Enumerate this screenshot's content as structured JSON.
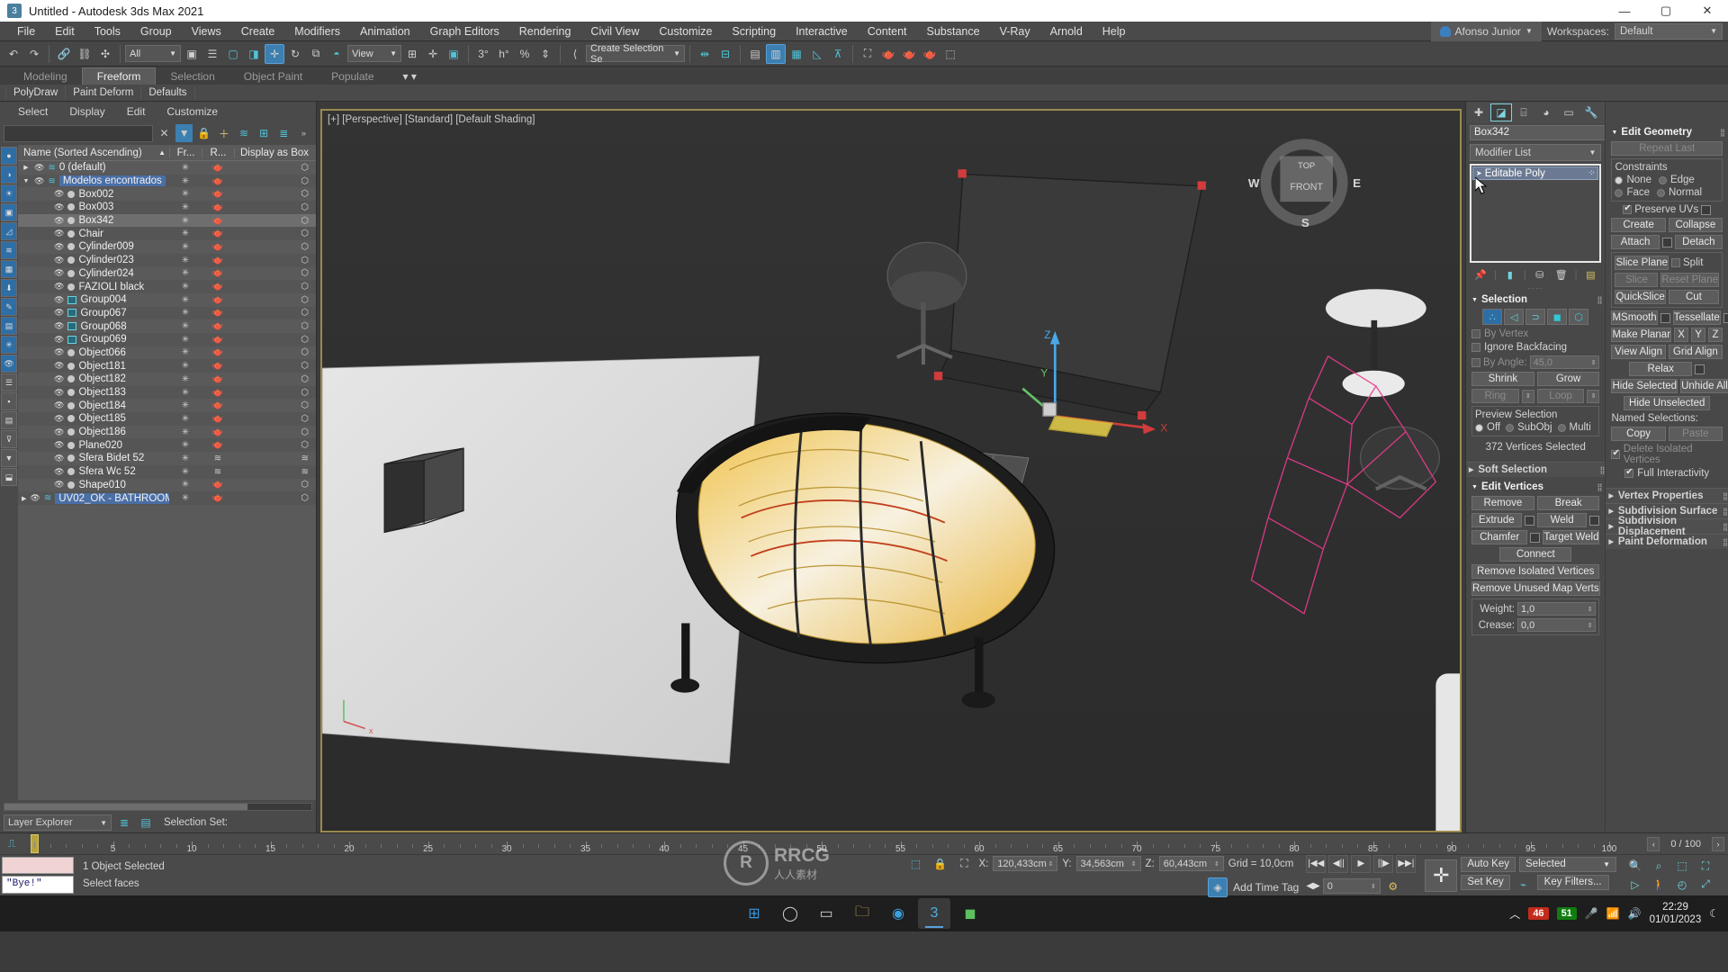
{
  "window": {
    "title": "Untitled - Autodesk 3ds Max 2021",
    "app_icon": "3ds-max-icon",
    "minimize": "—",
    "maximize": "▢",
    "close": "✕"
  },
  "menubar": {
    "items": [
      "File",
      "Edit",
      "Tools",
      "Group",
      "Views",
      "Create",
      "Modifiers",
      "Animation",
      "Graph Editors",
      "Rendering",
      "Civil View",
      "Customize",
      "Scripting",
      "Interactive",
      "Content",
      "Substance",
      "V-Ray",
      "Arnold",
      "Help"
    ],
    "user_name": "Afonso Junior",
    "workspaces_label": "Workspaces:",
    "workspace_value": "Default"
  },
  "toolbar": {
    "selection_filter": "All",
    "reference_coord": "View",
    "named_selection": "Create Selection Se",
    "icons": [
      "undo-icon",
      "redo-icon",
      "select-link-icon",
      "unlink-icon",
      "bind-space-warp-icon",
      "select-object-icon",
      "select-by-name-icon",
      "rect-select-icon",
      "window-crossing-icon",
      "select-and-move-icon",
      "select-and-rotate-icon",
      "select-and-scale-icon",
      "placement-icon",
      "use-center-icon",
      "select-and-manipulate-icon",
      "snap-toggle-icon",
      "angle-snap-icon",
      "percent-snap-icon",
      "spinner-snap-icon",
      "edit-named-selection-icon",
      "mirror-icon",
      "align-icon",
      "layer-explorer-icon",
      "scene-explorer-icon",
      "ribbon-icon",
      "curve-editor-icon",
      "schematic-icon",
      "render-setup-icon",
      "render-frame-icon",
      "render-production-icon",
      "render-iterative-icon",
      "render-active-shade-icon"
    ]
  },
  "ribbon": {
    "tabs": [
      "Modeling",
      "Freeform",
      "Selection",
      "Object Paint",
      "Populate"
    ],
    "active_tab": "Freeform",
    "sub_tabs": [
      "PolyDraw",
      "Paint Deform",
      "Defaults"
    ],
    "overflow_icon": "ribbon-menu-icon"
  },
  "explorer": {
    "menu": [
      "Select",
      "Display",
      "Edit",
      "Customize"
    ],
    "search_value": "",
    "search_placeholder": "",
    "toolbar_icons": [
      "clear-icon",
      "filter-icon",
      "lock-icon",
      "add-layer-icon",
      "layer-set-icon",
      "expand-tree-icon",
      "layers-icon"
    ],
    "columns": [
      "Name (Sorted Ascending)",
      "Fr...",
      "R...",
      "Display as Box"
    ],
    "sort_arrow": "▲",
    "rows": [
      {
        "name": "0 (default)",
        "type": "layer",
        "indent": 0,
        "expand": "▶",
        "selected": false,
        "highlight": false
      },
      {
        "name": "Modelos encontrados",
        "type": "layer",
        "indent": 0,
        "expand": "▼",
        "selected": false,
        "highlight": true
      },
      {
        "name": "Box002",
        "type": "object",
        "indent": 1,
        "expand": "",
        "selected": false,
        "highlight": false
      },
      {
        "name": "Box003",
        "type": "object",
        "indent": 1,
        "expand": "",
        "selected": false,
        "highlight": false
      },
      {
        "name": "Box342",
        "type": "object",
        "indent": 1,
        "expand": "",
        "selected": true,
        "highlight": false
      },
      {
        "name": "Chair",
        "type": "object",
        "indent": 1,
        "expand": "",
        "selected": false,
        "highlight": false
      },
      {
        "name": "Cylinder009",
        "type": "object",
        "indent": 1,
        "expand": "",
        "selected": false,
        "highlight": false
      },
      {
        "name": "Cylinder023",
        "type": "object",
        "indent": 1,
        "expand": "",
        "selected": false,
        "highlight": false
      },
      {
        "name": "Cylinder024",
        "type": "object",
        "indent": 1,
        "expand": "",
        "selected": false,
        "highlight": false
      },
      {
        "name": "FAZIOLI black",
        "type": "object",
        "indent": 1,
        "expand": "",
        "selected": false,
        "highlight": false
      },
      {
        "name": "Group004",
        "type": "group",
        "indent": 1,
        "expand": "",
        "selected": false,
        "highlight": false
      },
      {
        "name": "Group067",
        "type": "group",
        "indent": 1,
        "expand": "",
        "selected": false,
        "highlight": false
      },
      {
        "name": "Group068",
        "type": "group",
        "indent": 1,
        "expand": "",
        "selected": false,
        "highlight": false
      },
      {
        "name": "Group069",
        "type": "group",
        "indent": 1,
        "expand": "",
        "selected": false,
        "highlight": false
      },
      {
        "name": "Object066",
        "type": "object",
        "indent": 1,
        "expand": "",
        "selected": false,
        "highlight": false
      },
      {
        "name": "Object181",
        "type": "object",
        "indent": 1,
        "expand": "",
        "selected": false,
        "highlight": false
      },
      {
        "name": "Object182",
        "type": "object",
        "indent": 1,
        "expand": "",
        "selected": false,
        "highlight": false
      },
      {
        "name": "Object183",
        "type": "object",
        "indent": 1,
        "expand": "",
        "selected": false,
        "highlight": false
      },
      {
        "name": "Object184",
        "type": "object",
        "indent": 1,
        "expand": "",
        "selected": false,
        "highlight": false
      },
      {
        "name": "Object185",
        "type": "object",
        "indent": 1,
        "expand": "",
        "selected": false,
        "highlight": false
      },
      {
        "name": "Object186",
        "type": "object",
        "indent": 1,
        "expand": "",
        "selected": false,
        "highlight": false
      },
      {
        "name": "Plane020",
        "type": "object",
        "indent": 1,
        "expand": "",
        "selected": false,
        "highlight": false
      },
      {
        "name": "Sfera Bidet 52",
        "type": "object-layered",
        "indent": 1,
        "expand": "",
        "selected": false,
        "highlight": false
      },
      {
        "name": "Sfera Wc 52",
        "type": "object-layered",
        "indent": 1,
        "expand": "",
        "selected": false,
        "highlight": false
      },
      {
        "name": "Shape010",
        "type": "object",
        "indent": 1,
        "expand": "",
        "selected": false,
        "highlight": false
      },
      {
        "name": "UV02_OK - BATHROOM",
        "type": "layer",
        "indent": 0,
        "expand": "▶",
        "selected": false,
        "highlight": true
      }
    ],
    "footer": {
      "layer_explorer": "Layer Explorer",
      "selection_set_label": "Selection Set:",
      "selection_set_value": ""
    }
  },
  "viewport": {
    "label": "[+] [Perspective] [Standard] [Default Shading]",
    "viewcube": {
      "top": "TOP",
      "front": "FRONT",
      "west": "W",
      "east": "E",
      "south": "S"
    },
    "gizmo": {
      "x": "X",
      "y": "Y",
      "z": "Z"
    },
    "status_count": "372"
  },
  "command_panel": {
    "tabs": [
      "create-tab",
      "modify-tab",
      "hierarchy-tab",
      "motion-tab",
      "display-tab",
      "utilities-tab"
    ],
    "active_tab": "modify-tab",
    "object_name": "Box342",
    "color_swatch": "#f0c088",
    "modifier_list_label": "Modifier List",
    "stack": [
      {
        "name": "Editable Poly",
        "active": true
      }
    ],
    "stack_buttons": [
      "pin-stack-icon",
      "show-end-result-icon",
      "make-unique-icon",
      "remove-modifier-icon",
      "configure-sets-icon"
    ],
    "selection_rollout": {
      "title": "Selection",
      "sub_object_icons": [
        "vertex-icon",
        "edge-icon",
        "border-icon",
        "polygon-icon",
        "element-icon"
      ],
      "active_sub_object": "vertex-icon",
      "by_vertex": "By Vertex",
      "by_vertex_checked": false,
      "by_vertex_enabled": false,
      "ignore_backfacing": "Ignore Backfacing",
      "ignore_backfacing_checked": false,
      "by_angle": "By Angle:",
      "by_angle_value": "45,0",
      "by_angle_enabled": false,
      "shrink": "Shrink",
      "grow": "Grow",
      "ring": "Ring",
      "loop": "Loop",
      "preview_selection": "Preview Selection",
      "preview_options": [
        "Off",
        "SubObj",
        "Multi"
      ],
      "preview_active": "Off",
      "status": "372 Vertices Selected"
    },
    "soft_selection": {
      "title": "Soft Selection",
      "collapsed": true
    },
    "edit_vertices": {
      "title": "Edit Vertices",
      "remove": "Remove",
      "break": "Break",
      "extrude": "Extrude",
      "weld": "Weld",
      "chamfer": "Chamfer",
      "target_weld": "Target Weld",
      "connect": "Connect",
      "remove_isolated": "Remove Isolated Vertices",
      "remove_unused": "Remove Unused Map Verts",
      "weight_label": "Weight:",
      "weight_value": "1,0",
      "crease_label": "Crease:",
      "crease_value": "0,0"
    },
    "edit_geometry": {
      "title": "Edit Geometry",
      "repeat_last": "Repeat Last",
      "constraints_label": "Constraints",
      "constraints": [
        "None",
        "Edge",
        "Face",
        "Normal"
      ],
      "constraints_active": "None",
      "preserve_uvs": "Preserve UVs",
      "preserve_uvs_checked": true,
      "create": "Create",
      "collapse": "Collapse",
      "attach": "Attach",
      "detach": "Detach",
      "slice_plane": "Slice Plane",
      "split": "Split",
      "split_checked": false,
      "slice": "Slice",
      "reset_plane": "Reset Plane",
      "quickslice": "QuickSlice",
      "cut": "Cut",
      "msmooth": "MSmooth",
      "tessellate": "Tessellate",
      "make_planar": "Make Planar",
      "axis": [
        "X",
        "Y",
        "Z"
      ],
      "view_align": "View Align",
      "grid_align": "Grid Align",
      "relax": "Relax",
      "hide_selected": "Hide Selected",
      "unhide_all": "Unhide All",
      "hide_unselected": "Hide Unselected",
      "named_selections": "Named Selections:",
      "copy": "Copy",
      "paste": "Paste",
      "delete_isolated": "Delete Isolated Vertices",
      "delete_isolated_checked": true,
      "full_interactivity": "Full Interactivity",
      "full_interactivity_checked": true
    },
    "collapsed_rollouts": [
      "Vertex Properties",
      "Subdivision Surface",
      "Subdivision Displacement",
      "Paint Deformation"
    ]
  },
  "timeline": {
    "ticks": [
      0,
      5,
      10,
      15,
      20,
      25,
      30,
      35,
      40,
      45,
      50,
      55,
      60,
      65,
      70,
      75,
      80,
      85,
      90,
      95,
      100
    ],
    "current_frame": 0,
    "frame_field": "0 / 100"
  },
  "status": {
    "listener_text": "\"Bye!\"",
    "line1": "1 Object Selected",
    "line2": "Select faces",
    "coord_x_label": "X:",
    "coord_x": "120,433cm",
    "coord_y_label": "Y:",
    "coord_y": "34,563cm",
    "coord_z_label": "Z:",
    "coord_z": "60,443cm",
    "grid": "Grid = 10,0cm",
    "add_time_tag": "Add Time Tag",
    "auto_key": "Auto Key",
    "set_key": "Set Key",
    "key_mode": "Selected",
    "key_filters": "Key Filters...",
    "anim_frame": "0",
    "watermark_main": "RRCG",
    "watermark_sub": "人人素材"
  },
  "taskbar": {
    "items": [
      "start-icon",
      "search-icon",
      "taskview-icon",
      "explorer-icon",
      "edge-icon",
      "chrome-icon",
      "max-icon",
      "app-green-icon"
    ],
    "tray": {
      "chevron": "︿",
      "badge_red": "46",
      "badge_green": "51",
      "mic": "mic-icon",
      "wifi": "wifi-icon",
      "volume": "volume-icon",
      "time": "22:29",
      "date": "01/01/2023",
      "moon": "moon-icon"
    },
    "badge_red_color": "#c42b1c",
    "badge_green_color": "#107c10"
  }
}
